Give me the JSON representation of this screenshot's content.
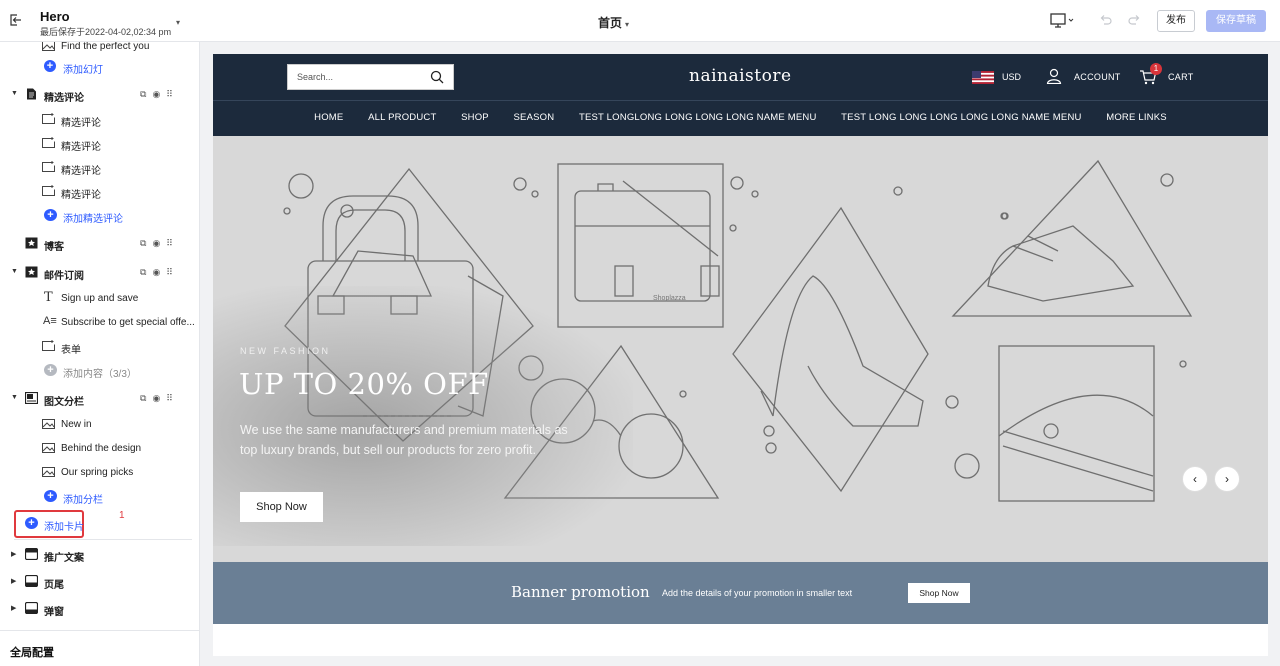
{
  "topbar": {
    "title": "Hero",
    "subtitle": "最后保存于2022-04-02,02:34 pm",
    "page_label": "首页",
    "publish_label": "发布",
    "save_draft_label": "保存草稿"
  },
  "sidebar": {
    "items": [
      {
        "label": "Find the perfect you"
      },
      {
        "label": "添加幻灯"
      },
      {
        "label": "精选评论"
      },
      {
        "label": "精选评论"
      },
      {
        "label": "精选评论"
      },
      {
        "label": "精选评论"
      },
      {
        "label": "精选评论"
      },
      {
        "label": "添加精选评论"
      },
      {
        "label": "博客"
      },
      {
        "label": "邮件订阅"
      },
      {
        "label": "Sign up and save"
      },
      {
        "label": "Subscribe to get special offe..."
      },
      {
        "label": "表单"
      },
      {
        "label": "添加内容（3/3）"
      },
      {
        "label": "图文分栏"
      },
      {
        "label": "New in"
      },
      {
        "label": "Behind the design"
      },
      {
        "label": "Our spring picks"
      },
      {
        "label": "添加分栏"
      },
      {
        "label": "添加卡片"
      },
      {
        "label": "推广文案"
      },
      {
        "label": "页尾"
      },
      {
        "label": "弹窗"
      }
    ],
    "annotation_number": "1",
    "global_config": "全局配置"
  },
  "store": {
    "search_placeholder": "Search...",
    "logo": "nainaistore",
    "currency": "USD",
    "account": "ACCOUNT",
    "cart": "CART",
    "cart_count": "1",
    "nav": [
      "HOME",
      "ALL PRODUCT",
      "SHOP",
      "SEASON",
      "TEST LONGLONG LONG LONG LONG NAME MENU",
      "TEST LONG LONG LONG LONG LONG NAME MENU",
      "MORE LINKS"
    ]
  },
  "hero": {
    "kicker": "NEW FASHION",
    "title": "UP TO 20% OFF",
    "body": "We use the same manufacturers and premium materials as top luxury brands, but sell our products for zero profit.",
    "button": "Shop Now",
    "watermark": "Shoplazza"
  },
  "banner": {
    "title": "Banner promotion",
    "subtitle": "Add the details of your promotion in smaller text",
    "button": "Shop Now"
  },
  "colors": {
    "primary": "#2e5bff",
    "store_header": "#1c2a3c",
    "banner": "#6a7f95",
    "highlight": "#e0393e"
  }
}
